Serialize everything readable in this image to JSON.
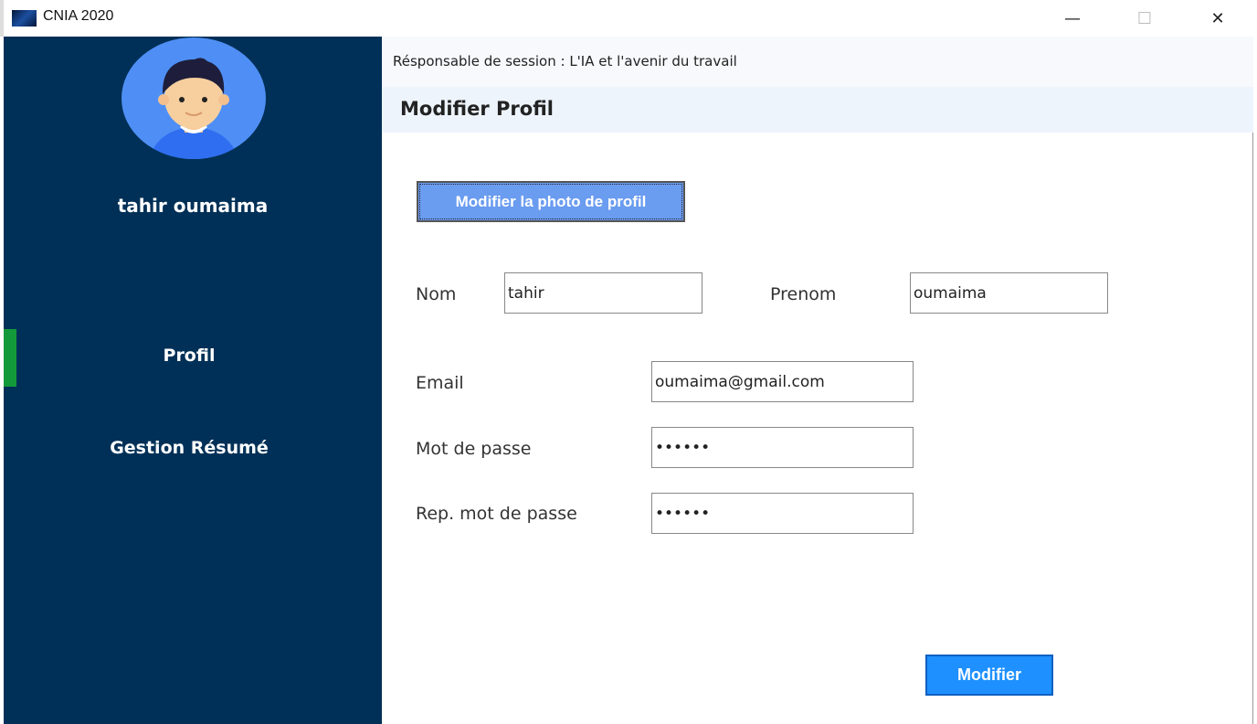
{
  "window": {
    "title": "CNIA 2020",
    "minimize": "—",
    "maximize": "☐",
    "close": "✕"
  },
  "sidebar": {
    "user_name": "tahir oumaima",
    "items": [
      {
        "label": "Profil",
        "active": true
      },
      {
        "label": "Gestion Résumé",
        "active": false
      }
    ],
    "active_color": "#129a3a"
  },
  "header": {
    "session": "Résponsable de session : L'IA et l'avenir du travail",
    "page_title": "Modifier Profil"
  },
  "form": {
    "photo_button": "Modifier la photo de profil",
    "nom_label": "Nom",
    "nom_value": "tahir",
    "prenom_label": "Prenom",
    "prenom_value": "oumaima",
    "email_label": "Email",
    "email_value": "oumaima@gmail.com",
    "password_label": "Mot de passe",
    "password_value": "oumaim",
    "repeat_label": "Rep. mot de passe",
    "repeat_value": "oumaim",
    "submit": "Modifier"
  }
}
